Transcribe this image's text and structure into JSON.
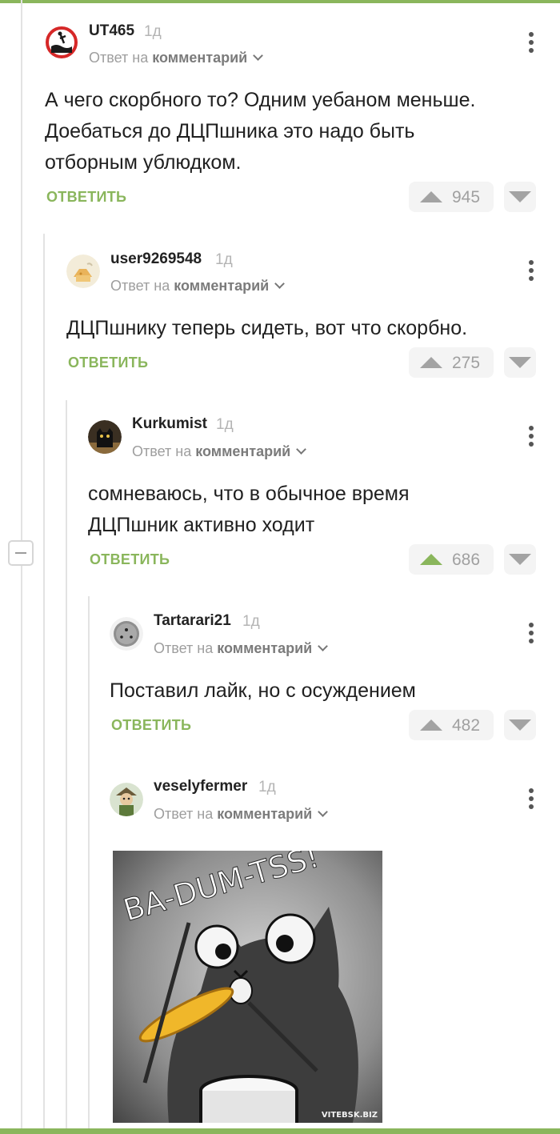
{
  "labels": {
    "reply_to_prefix": "Ответ на",
    "reply_to_target": "комментарий",
    "reply_button": "ОТВЕТИТЬ"
  },
  "colors": {
    "accent": "#8ab65c",
    "text": "#202020",
    "muted": "#9e9e9e",
    "vote_bg": "#f4f4f4"
  },
  "comments": [
    {
      "author": "UT465",
      "age": "1д",
      "avatar_icon": "warning-sinking-person-icon",
      "lines": [
        "А чего скорбного то? Одним уебаном меньше.",
        "Доебаться до ДЦПшника это надо быть",
        "отборным ублюдком."
      ],
      "score": "945",
      "upvoted": false
    },
    {
      "author": "user9269548",
      "age": "1д",
      "avatar_icon": "cheese-house-icon",
      "lines": [
        "ДЦПшнику теперь сидеть, вот что скорбно."
      ],
      "score": "275",
      "upvoted": false
    },
    {
      "author": "Kurkumist",
      "age": "1д",
      "avatar_icon": "black-cat-icon",
      "lines": [
        "сомневаюсь, что в обычное время",
        "ДЦПшник активно ходит"
      ],
      "score": "686",
      "upvoted": true
    },
    {
      "author": "Tartarari21",
      "age": "1д",
      "avatar_icon": "grey-disc-icon",
      "lines": [
        "Поставил лайк, но с осуждением"
      ],
      "score": "482",
      "upvoted": false
    },
    {
      "author": "veselyfermer",
      "age": "1д",
      "avatar_icon": "cartoon-character-icon",
      "lines": [],
      "score": "",
      "upvoted": false
    }
  ],
  "meme": {
    "caption": "BA-DUM-TSS!",
    "watermark": "VITEBSK.BIZ",
    "subject": "cartoon-cat-drummer-image"
  }
}
